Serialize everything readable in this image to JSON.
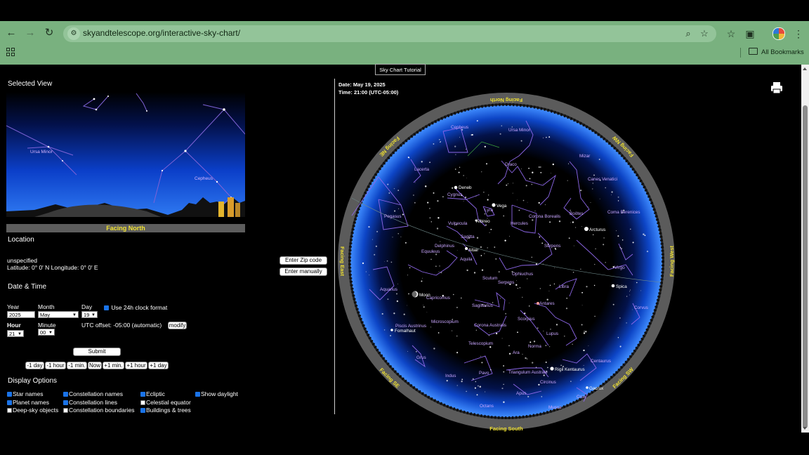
{
  "browser": {
    "url": "skyandtelescope.org/interactive-sky-chart/",
    "bookmarks_label": "All Bookmarks"
  },
  "tutorial_label": "Sky Chart Tutorial",
  "selected_view": {
    "heading": "Selected View",
    "facing": "Facing North",
    "labels": [
      "Ursa Minor",
      "Cepheus"
    ]
  },
  "location": {
    "heading": "Location",
    "name": "unspecified",
    "coords": "Latitude: 0° 0' N Longitude: 0° 0' E",
    "zip_button": "Enter Zip code",
    "manual_button": "Enter manually"
  },
  "datetime": {
    "heading": "Date & Time",
    "year_label": "Year",
    "year_value": "2025",
    "month_label": "Month",
    "month_value": "May",
    "day_label": "Day",
    "day_value": "19",
    "clock_label": "Use 24h clock format",
    "hour_label": "Hour",
    "hour_value": "21",
    "minute_label": "Minute",
    "minute_value": "00",
    "utc_text": "UTC offset: -05:00 (automatic)",
    "modify_label": "modify",
    "submit_label": "Submit",
    "steps": [
      "-1 day",
      "-1 hour",
      "-1 min.",
      "Now",
      "+1 min.",
      "+1 hour",
      "+1 day"
    ]
  },
  "display_options": {
    "heading": "Display Options",
    "options": [
      {
        "label": "Star names",
        "checked": true
      },
      {
        "label": "Constellation names",
        "checked": true
      },
      {
        "label": "Ecliptic",
        "checked": true
      },
      {
        "label": "Show daylight",
        "checked": true
      },
      {
        "label": "Planet names",
        "checked": true
      },
      {
        "label": "Constellation lines",
        "checked": true
      },
      {
        "label": "Celestial equator",
        "checked": false
      },
      {
        "label": "Deep-sky objects",
        "checked": false
      },
      {
        "label": "Constellation boundaries",
        "checked": false
      },
      {
        "label": "Buildings & trees",
        "checked": true
      }
    ]
  },
  "chart": {
    "date_text": "Date: May 19, 2025",
    "time_text": "Time: 21:00 (UTC-05:00)",
    "directions": {
      "north": "Facing North",
      "south": "Facing South",
      "east": "Facing East",
      "west": "Facing West",
      "ne": "Facing NE",
      "nw": "Facing NW",
      "se": "Facing SE",
      "sw": "Facing SW"
    },
    "constellations": [
      "Cepheus",
      "Ursa Minor",
      "Lacerta",
      "Draco",
      "Mizar",
      "Canes Venatici",
      "Cygnus",
      "Lyra",
      "Corona Borealis",
      "Boötes",
      "Coma Berenices",
      "Pegasus",
      "Vulpecula",
      "Hercules",
      "Delphinus",
      "Sagitta",
      "Equuleus",
      "Serpens",
      "Aquila",
      "Virgo",
      "Ophiuchus",
      "Scutum",
      "Serpens",
      "Aquarius",
      "Capricornus",
      "Libra",
      "Sagittarius",
      "Antares",
      "Corvus",
      "Microscopium",
      "Scorpius",
      "Piscis Austrinus",
      "Corona Australis",
      "Lupus",
      "Telescopium",
      "Norma",
      "Grus",
      "Ara",
      "Centaurus",
      "Indus",
      "Pavo",
      "Triangulum Australe",
      "Circinus",
      "Apus",
      "Octans",
      "Musca",
      "Crux"
    ],
    "stars": [
      "Deneb",
      "Vega",
      "Albireo",
      "Altair",
      "Arcturus",
      "Spica",
      "Fomalhaut",
      "Rigil Kentaurus",
      "Gacrux"
    ],
    "moon_label": "Moon"
  }
}
